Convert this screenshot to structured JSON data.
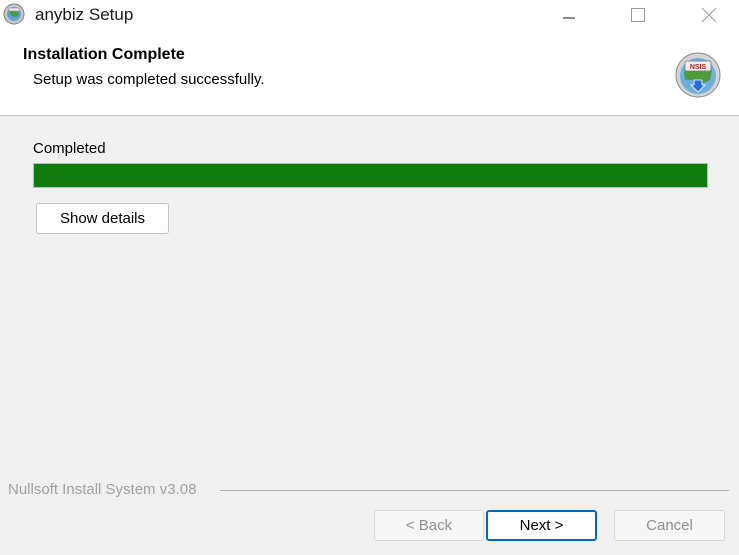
{
  "window": {
    "title": "anybiz Setup",
    "icons": {
      "app": "installer-globe-icon",
      "minimize": "minimize-icon",
      "maximize": "maximize-icon",
      "close": "close-icon"
    }
  },
  "header": {
    "title": "Installation Complete",
    "subtitle": "Setup was completed successfully.",
    "logo_icon": "nsis-logo-icon",
    "logo_text": "NSIS"
  },
  "main": {
    "status_label": "Completed",
    "progress_percent": 100,
    "progress_color": "#107c10",
    "show_details_label": "Show details"
  },
  "footer": {
    "brand": "Nullsoft Install System v3.08",
    "back_label": "< Back",
    "next_label": "Next >",
    "cancel_label": "Cancel"
  },
  "colors": {
    "accent": "#0067c0",
    "background": "#f0f0f0",
    "header_background": "#ffffff"
  }
}
